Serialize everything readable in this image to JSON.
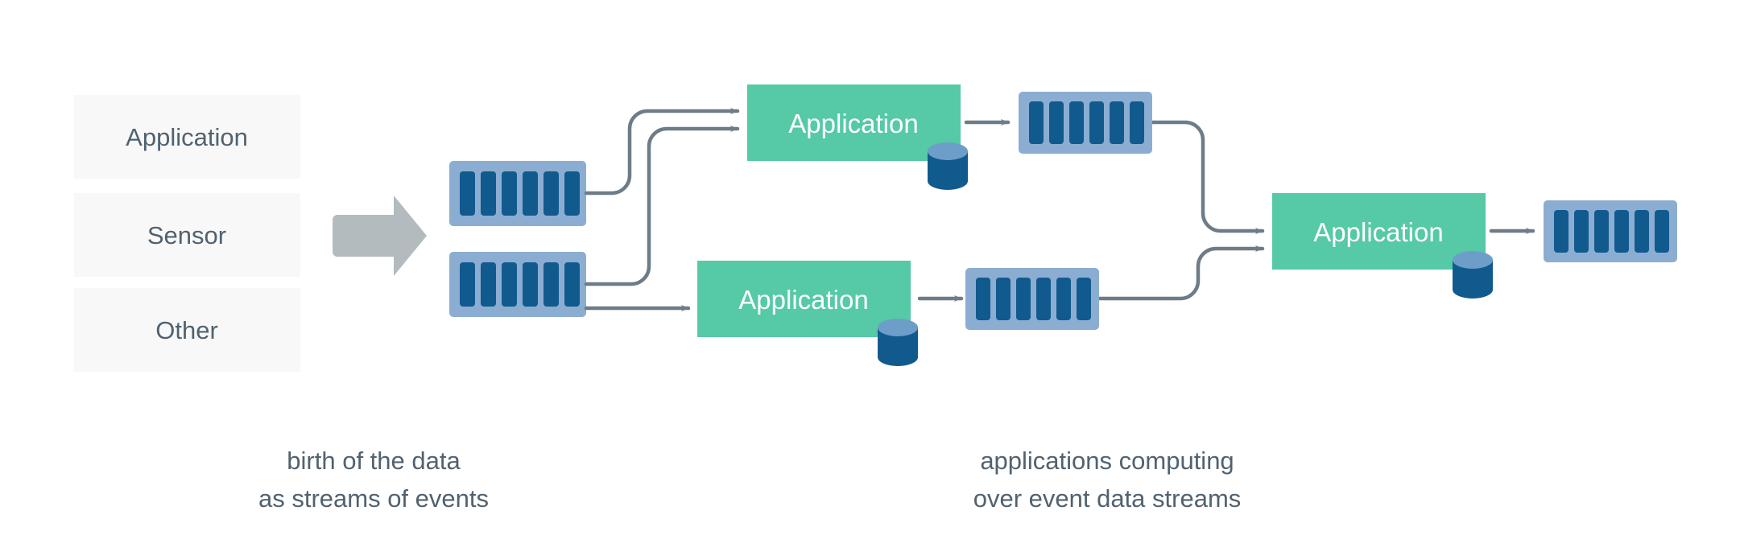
{
  "diagram": {
    "title": "event streaming data flow",
    "colors": {
      "source_box_fill": "#f8f8f8",
      "source_text": "#51626f",
      "gray_arrow": "#b3bbbf",
      "stream_outer": "#8cadd2",
      "stream_bar": "#115a8e",
      "application_fill": "#56c9a7",
      "application_text": "#ffffff",
      "db_top": "#6d9ec9",
      "db_body": "#115a8e",
      "connector": "#6e7c87",
      "caption_text": "#51626f",
      "background": "#ffffff"
    },
    "sources": {
      "name": "data sources",
      "items": [
        {
          "label": "Application"
        },
        {
          "label": "Sensor"
        },
        {
          "label": "Other"
        }
      ]
    },
    "ingest_arrow": {
      "icon": "fat-right-arrow-icon"
    },
    "input_streams": [
      {
        "name": "input-stream-1",
        "bars": 6
      },
      {
        "name": "input-stream-2",
        "bars": 6
      }
    ],
    "applications": [
      {
        "name": "application-top",
        "label": "Application",
        "has_database": true
      },
      {
        "name": "application-bottom",
        "label": "Application",
        "has_database": true
      },
      {
        "name": "application-final",
        "label": "Application",
        "has_database": true
      }
    ],
    "output_streams": [
      {
        "name": "output-stream-top",
        "bars": 6
      },
      {
        "name": "output-stream-bottom",
        "bars": 6
      },
      {
        "name": "output-stream-final",
        "bars": 6
      }
    ],
    "captions": [
      {
        "name": "caption-left",
        "line1": "birth of the data",
        "line2": "as streams of events"
      },
      {
        "name": "caption-right",
        "line1": "applications computing",
        "line2": "over event data streams"
      }
    ]
  }
}
